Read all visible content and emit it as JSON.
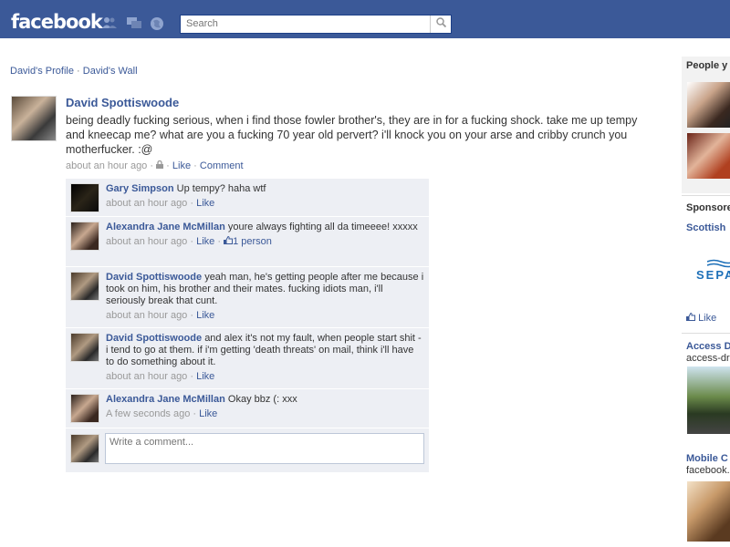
{
  "header": {
    "logo": "facebook",
    "search_placeholder": "Search",
    "jewels": [
      "friend-requests",
      "messages",
      "notifications"
    ]
  },
  "breadcrumb": {
    "profile": "David's Profile",
    "sep": "·",
    "wall": "David's Wall"
  },
  "post": {
    "author": "David Spottiswoode",
    "message": "being deadly fucking serious, when i find those fowler brother's, they are in for a fucking shock. take me up tempy and kneecap me? what are you a fucking 70 year old pervert? i'll knock you on your arse and cribby crunch you motherfucker. :@",
    "time": "about an hour ago",
    "dot": "·",
    "like": "Like",
    "comment": "Comment"
  },
  "comments": [
    {
      "author": "Gary Simpson",
      "text": "Up tempy? haha wtf",
      "time": "about an hour ago",
      "like": "Like",
      "likes": ""
    },
    {
      "author": "Alexandra Jane McMillan",
      "text": "youre always fighting all da timeeee! xxxxx",
      "time": "about an hour ago",
      "like": "Like",
      "likes": "1 person"
    },
    {
      "author": "David Spottiswoode",
      "text": "yeah man, he's getting people after me because i took on him, his brother and their mates. fucking idiots man, i'll seriously break that cunt.",
      "time": "about an hour ago",
      "like": "Like",
      "likes": ""
    },
    {
      "author": "David Spottiswoode",
      "text": "and alex it's not my fault, when people start shit - i tend to go at them. if i'm getting 'death threats' on mail, think i'll have to do something about it.",
      "time": "about an hour ago",
      "like": "Like",
      "likes": ""
    },
    {
      "author": "Alexandra Jane McMillan",
      "text": "Okay bbz (: xxx",
      "time": "A few seconds ago",
      "like": "Like",
      "likes": ""
    }
  ],
  "write_comment_placeholder": "Write a comment...",
  "right_column": {
    "people_heading": "People y",
    "sponsored_heading": "Sponsore",
    "ad1_title": "Scottish",
    "ad1_logo": "SEPA",
    "ad1_like": "Like",
    "ad2_title": "Access D",
    "ad2_url": "access-dri",
    "ad3_title": "Mobile C",
    "ad3_url": "facebook."
  },
  "colors": {
    "brand_blue": "#3b5998",
    "comment_bg": "#edeff4"
  }
}
